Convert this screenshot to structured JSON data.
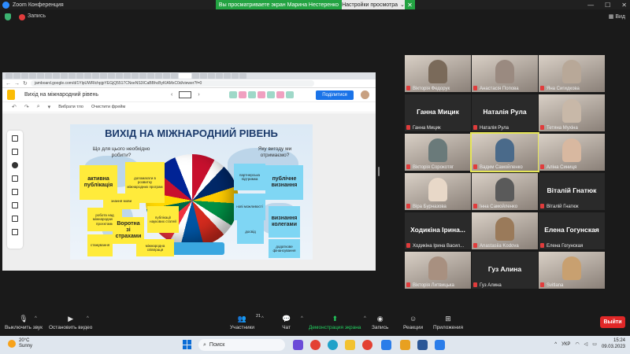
{
  "window": {
    "title": "Zoom Конференция",
    "controls": [
      "—",
      "☐",
      "✕"
    ]
  },
  "share_banner": {
    "text": "Вы просматриваете экран Марина Нестеренко",
    "view_options": "Настройки просмотра",
    "view_options_caret": "⌄",
    "close": "✕"
  },
  "recording": {
    "label": "Запись",
    "view": "Вид"
  },
  "shared_screen": {
    "browser": {
      "url": "jamboard.google.com/d/1YlpUWRlchpjpYEGjQ5517CNxeNS3ICaBBhcByKlAMxC0d/viewer?f=0",
      "nav_back": "←",
      "nav_forward": "→",
      "nav_reload": "↻"
    },
    "app": {
      "doc_title": "Вихід на міжнародний рівень",
      "frame_prev": "‹",
      "frame_next": "›",
      "share_button": "Поділитися"
    },
    "tools": {
      "undo": "↶",
      "redo": "↷",
      "zoom": "⌕",
      "zoom_caret": "▾",
      "background": "Вибрати тло",
      "clear": "Очистити фрейм"
    },
    "board": {
      "title": "ВИХІД НА МІЖНАРОДНИЙ РІВЕНЬ",
      "question_left": "Що для цього необхідно робити?",
      "question_right": "Яку вигоду ми отримаємо?",
      "stickies": [
        "активна публікація",
        "допомагати в розвитку міжнародних програм",
        "знання мови",
        "робота над міжнародними проєктами",
        "Воротна зі страхами",
        "публікації наукових статей",
        "стажування",
        "міжнародна співпраця",
        "партнерська підтримка",
        "нові можливості",
        "публічне визнання",
        "визнання колегами",
        "досвід",
        "додаткове фінансування"
      ]
    }
  },
  "participants": [
    {
      "name": "Вікторія Федорук",
      "display": "",
      "color": "#7a6a5a"
    },
    {
      "name": "Анастасія Попова",
      "display": "",
      "color": "#9a8a80"
    },
    {
      "name": "Яна Сигидкова",
      "display": "",
      "color": "#b8a898"
    },
    {
      "name": "Ганна Мицик",
      "display": "Ганна Мицик",
      "color": ""
    },
    {
      "name": "Наталія Рула",
      "display": "Наталія Рула",
      "color": ""
    },
    {
      "name": "Тетяна Мухіна",
      "display": "",
      "color": "#c8b8a8"
    },
    {
      "name": "Вікторія Сорокотяг",
      "display": "",
      "color": "#6a7a7a"
    },
    {
      "name": "Вадим Самойленко",
      "display": "",
      "color": "#4a6a8a"
    },
    {
      "name": "Аліна Синиця",
      "display": "",
      "color": "#d8b8a0"
    },
    {
      "name": "Віра Бурназова",
      "display": "",
      "color": "#e8d8c8"
    },
    {
      "name": "Інна Самойленко",
      "display": "",
      "color": "#5a5a5a"
    },
    {
      "name": "Віталій Гнатюк",
      "display": "Віталій Гнатюк",
      "color": ""
    },
    {
      "name": "Ходикіна Ірина Васил...",
      "display": "Ходикіна Ірина...",
      "color": ""
    },
    {
      "name": "Anastasiia Kodova",
      "display": "",
      "color": "#9a7a5a"
    },
    {
      "name": "Елена Гогунская",
      "display": "Елена Гогунская",
      "color": ""
    },
    {
      "name": "Вікторія Литвицька",
      "display": "",
      "color": "#a89080"
    },
    {
      "name": "Гуз Алина",
      "display": "Гуз Алина",
      "color": ""
    },
    {
      "name": "Svitlana",
      "display": "",
      "color": "#c8a070"
    }
  ],
  "toolbar": {
    "mute": "Выключить звук",
    "video": "Остановить видео",
    "participants": "Участники",
    "participants_count": "21",
    "chat": "Чат",
    "share": "Демонстрация экрана",
    "record": "Запись",
    "reactions": "Реакции",
    "apps": "Приложения",
    "leave": "Выйти",
    "caret": "^"
  },
  "taskbar": {
    "weather_temp": "20°C",
    "weather_desc": "Sunny",
    "search": "Поиск",
    "lang": "УКР",
    "time": "15:24",
    "date": "09.03.2023",
    "tray_arrow": "^"
  },
  "colors": {
    "zoom_green": "#23a342",
    "leave_red": "#e02828",
    "sticky_yellow": "#ffeb3b",
    "sticky_blue": "#7fd6f4",
    "active_speaker": "#e6e657"
  }
}
